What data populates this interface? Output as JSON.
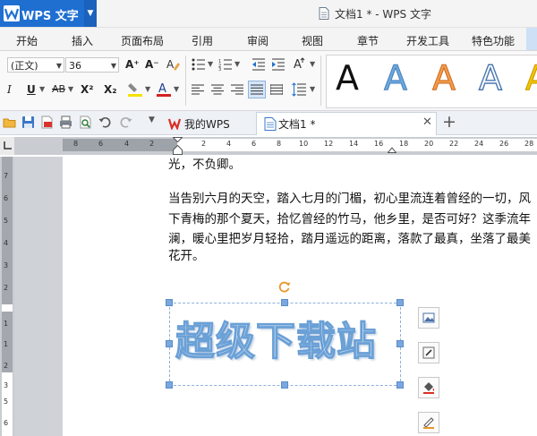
{
  "app": {
    "name": "WPS 文字",
    "window_title": "文档1 * - WPS 文字"
  },
  "menu": {
    "items": [
      "开始",
      "插入",
      "页面布局",
      "引用",
      "审阅",
      "视图",
      "章节",
      "开发工具",
      "特色功能"
    ]
  },
  "ribbon": {
    "style_value": "(正文)",
    "font_size": "36",
    "grow_font": "A⁺",
    "shrink_font": "A⁻",
    "italic": "I",
    "underline": "U",
    "strikethrough": "AB",
    "superscript": "X²",
    "subscript": "X₂",
    "style_samples": [
      "A",
      "A",
      "A",
      "A",
      "A"
    ],
    "colors": {
      "highlight": "#f5e100",
      "font_color": "#d42020",
      "accent": "#1f6fd1"
    }
  },
  "tabs": {
    "my_wps": "我的WPS",
    "doc": "文档1 *",
    "add": "+"
  },
  "ruler": {
    "h_numbers": [
      "8",
      "6",
      "4",
      "2",
      "2",
      "4",
      "6",
      "8",
      "10",
      "12",
      "14",
      "16",
      "18",
      "20",
      "22",
      "24",
      "26",
      "28"
    ],
    "v_numbers": [
      "7",
      "6",
      "5",
      "4",
      "3",
      "2",
      "1",
      "1",
      "2",
      "3",
      "5",
      "6"
    ]
  },
  "document": {
    "lines": [
      "光，不负卿。",
      "当告别六月的天空，踏入七月的门楣，初心里流连着曾经的一切，风",
      "下青梅的那个夏天，拾忆曾经的竹马，他乡里，是否可好？这季流年",
      "澜，暖心里把岁月轻拾，踏月遥远的距离，落款了最真，坐落了最美",
      "花开。"
    ],
    "wordart": "超级下载站"
  }
}
